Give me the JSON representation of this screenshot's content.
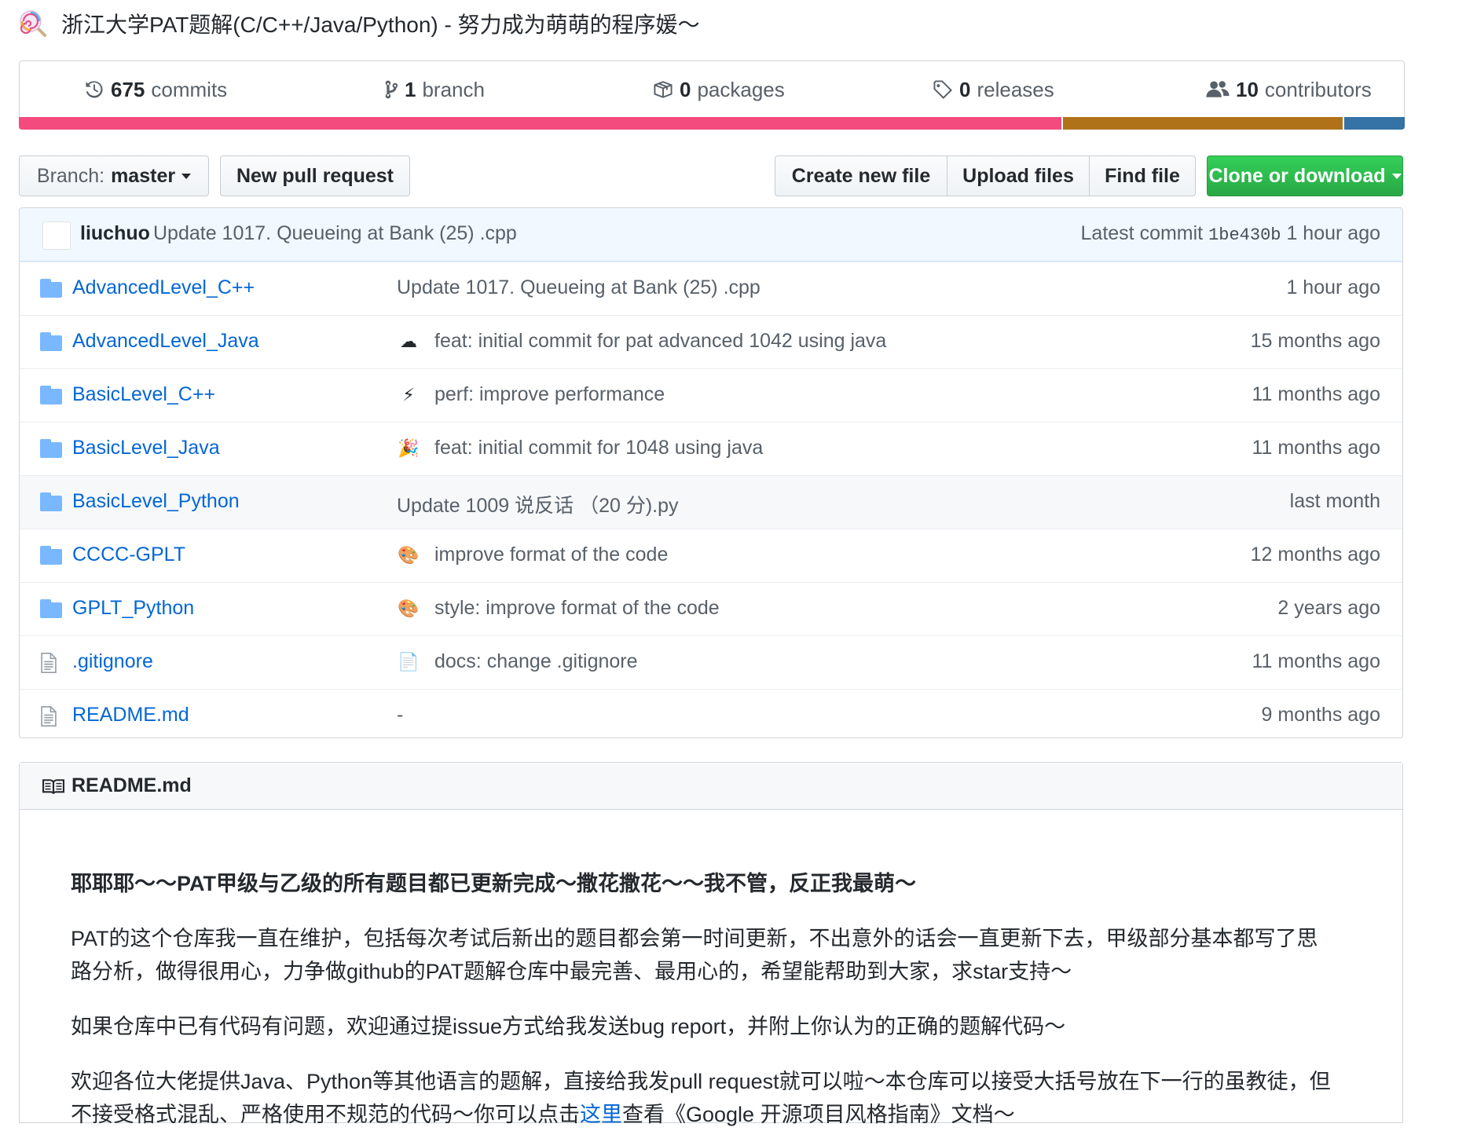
{
  "repo": {
    "title": "浙江大学PAT题解(C/C++/Java/Python) - 努力成为萌萌的程序媛～"
  },
  "summary": {
    "commits": {
      "count": "675",
      "label": "commits"
    },
    "branches": {
      "count": "1",
      "label": "branch"
    },
    "packages": {
      "count": "0",
      "label": "packages"
    },
    "releases": {
      "count": "0",
      "label": "releases"
    },
    "contributors": {
      "count": "10",
      "label": "contributors"
    }
  },
  "language_bar": [
    {
      "color": "#f34b7d",
      "share": 0.754
    },
    {
      "color": "#b07219",
      "share": 0.202
    },
    {
      "color": "#3572A5",
      "share": 0.044
    }
  ],
  "toolbar": {
    "branch_prefix": "Branch:",
    "branch_name": "master",
    "new_pull_request": "New pull request",
    "create_new_file": "Create new file",
    "upload_files": "Upload files",
    "find_file": "Find file",
    "clone_or_download": "Clone or download"
  },
  "latest_commit": {
    "author": "liuchuo",
    "message": "Update 1017. Queueing at Bank (25) .cpp",
    "label": "Latest commit",
    "sha": "1be430b",
    "age": "1 hour ago"
  },
  "files": [
    {
      "type": "folder",
      "name": "AdvancedLevel_C++",
      "emoji": "",
      "message": "Update 1017. Queueing at Bank (25) .cpp",
      "age": "1 hour ago"
    },
    {
      "type": "folder",
      "name": "AdvancedLevel_Java",
      "emoji": "☁",
      "message": "feat: initial commit for pat advanced 1042 using java",
      "age": "15 months ago"
    },
    {
      "type": "folder",
      "name": "BasicLevel_C++",
      "emoji": "⚡",
      "message": "perf: improve performance",
      "age": "11 months ago"
    },
    {
      "type": "folder",
      "name": "BasicLevel_Java",
      "emoji": "🎉",
      "message": "feat: initial commit for 1048 using java",
      "age": "11 months ago"
    },
    {
      "type": "folder",
      "name": "BasicLevel_Python",
      "emoji": "",
      "message": "Update 1009 说反话 （20 分).py",
      "age": "last month"
    },
    {
      "type": "folder",
      "name": "CCCC-GPLT",
      "emoji": "🎨",
      "message": "improve format of the code",
      "age": "12 months ago"
    },
    {
      "type": "folder",
      "name": "GPLT_Python",
      "emoji": "🎨",
      "message": "style: improve format of the code",
      "age": "2 years ago"
    },
    {
      "type": "file",
      "name": ".gitignore",
      "emoji": "📄",
      "message": "docs: change .gitignore",
      "age": "11 months ago"
    },
    {
      "type": "file",
      "name": "README.md",
      "emoji": "",
      "message": "-",
      "age": "9 months ago"
    }
  ],
  "readme": {
    "header": "README.md",
    "p1": "耶耶耶～～PAT甲级与乙级的所有题目都已更新完成～撒花撒花～～我不管，反正我最萌～",
    "p2": "PAT的这个仓库我一直在维护，包括每次考试后新出的题目都会第一时间更新，不出意外的话会一直更新下去，甲级部分基本都写了思路分析，做得很用心，力争做github的PAT题解仓库中最完善、最用心的，希望能帮助到大家，求star支持～",
    "p3": "如果仓库中已有代码有问题，欢迎通过提issue方式给我发送bug report，并附上你认为的正确的题解代码～",
    "p4_a": "欢迎各位大佬提供Java、Python等其他语言的题解，直接给我发pull request就可以啦～本仓库可以接受大括号放在下一行的虽教徒，但不接受格式混乱、严格使用不规范的代码～你可以点击",
    "p4_link": "这里",
    "p4_b": "查看《Google 开源项目风格指南》文档～"
  }
}
